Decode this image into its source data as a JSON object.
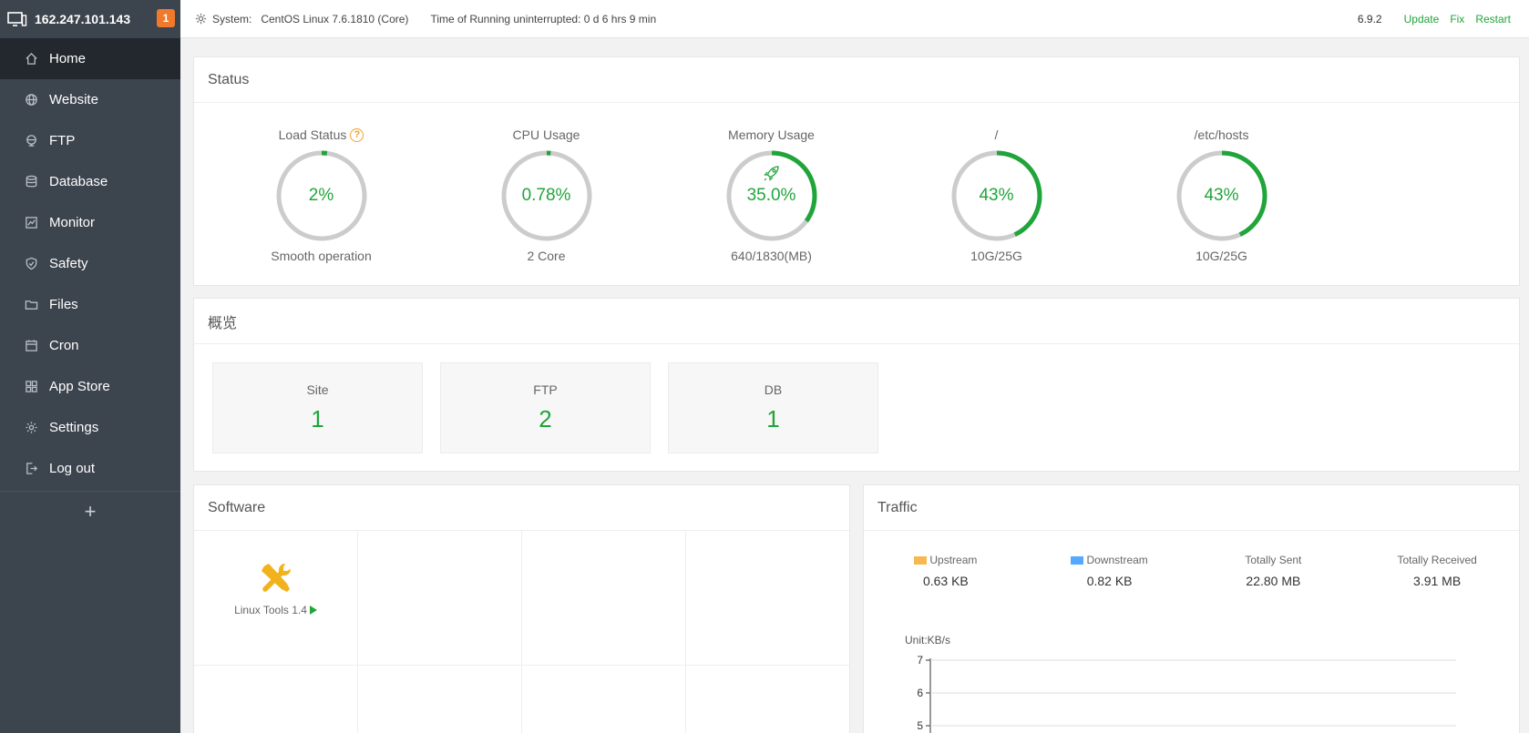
{
  "sidebar": {
    "ip": "162.247.101.143",
    "badge": "1",
    "items": [
      {
        "label": "Home"
      },
      {
        "label": "Website"
      },
      {
        "label": "FTP"
      },
      {
        "label": "Database"
      },
      {
        "label": "Monitor"
      },
      {
        "label": "Safety"
      },
      {
        "label": "Files"
      },
      {
        "label": "Cron"
      },
      {
        "label": "App Store"
      },
      {
        "label": "Settings"
      },
      {
        "label": "Log out"
      }
    ],
    "add_label": "+"
  },
  "topbar": {
    "system_label": "System:",
    "system_value": "CentOS Linux 7.6.1810 (Core)",
    "uptime": "Time of Running uninterrupted: 0 d 6 hrs 9 min",
    "version": "6.9.2",
    "update": "Update",
    "fix": "Fix",
    "restart": "Restart"
  },
  "status": {
    "title": "Status",
    "gauges": [
      {
        "title": "Load Status",
        "help": "?",
        "value": "2%",
        "percent": 2,
        "sub": "Smooth operation"
      },
      {
        "title": "CPU Usage",
        "value": "0.78%",
        "percent": 0.78,
        "sub": "2 Core"
      },
      {
        "title": "Memory Usage",
        "value": "35.0%",
        "percent": 35.0,
        "sub": "640/1830(MB)",
        "icon": "rocket-icon"
      },
      {
        "title": "/",
        "value": "43%",
        "percent": 43,
        "sub": "10G/25G"
      },
      {
        "title": "/etc/hosts",
        "value": "43%",
        "percent": 43,
        "sub": "10G/25G"
      }
    ],
    "ring_color": "#20a53a",
    "ring_track": "#cccccc"
  },
  "overview": {
    "title": "概览",
    "boxes": [
      {
        "label": "Site",
        "count": "1"
      },
      {
        "label": "FTP",
        "count": "2"
      },
      {
        "label": "DB",
        "count": "1"
      }
    ]
  },
  "software": {
    "title": "Software",
    "items": [
      {
        "name": "Linux Tools 1.4",
        "icon": "tools-icon"
      }
    ]
  },
  "traffic": {
    "title": "Traffic",
    "stats": [
      {
        "label": "Upstream",
        "value": "0.63 KB",
        "swatch": "#f7b851"
      },
      {
        "label": "Downstream",
        "value": "0.82 KB",
        "swatch": "#52a9ff"
      },
      {
        "label": "Totally Sent",
        "value": "22.80 MB"
      },
      {
        "label": "Totally Received",
        "value": "3.91 MB"
      }
    ],
    "chart_data": {
      "type": "line",
      "ylabel": "Unit:KB/s",
      "yticks": [
        7,
        6,
        5
      ],
      "series": []
    }
  }
}
